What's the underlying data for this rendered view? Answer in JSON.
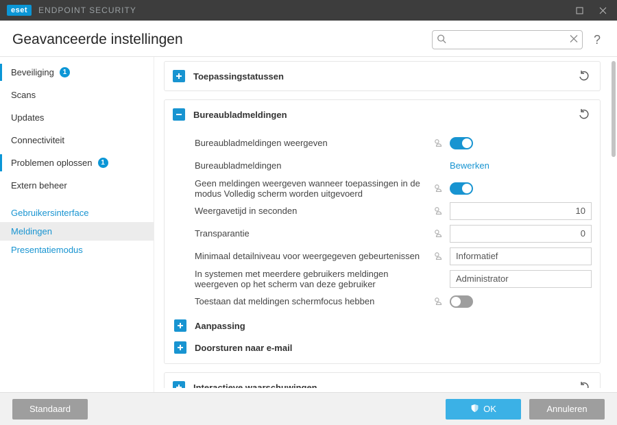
{
  "app": {
    "brand": "eset",
    "product": "ENDPOINT SECURITY"
  },
  "header": {
    "title": "Geavanceerde instellingen",
    "search_placeholder": "",
    "help_text": "?"
  },
  "sidebar": {
    "items": [
      {
        "label": "Beveiliging",
        "badge": "1"
      },
      {
        "label": "Scans"
      },
      {
        "label": "Updates"
      },
      {
        "label": "Connectiviteit"
      },
      {
        "label": "Problemen oplossen",
        "badge": "1"
      },
      {
        "label": "Extern beheer"
      }
    ],
    "subs": [
      {
        "label": "Gebruikersinterface"
      },
      {
        "label": "Meldingen"
      },
      {
        "label": "Presentatiemodus"
      }
    ]
  },
  "panels": {
    "app_statuses": {
      "title": "Toepassingstatussen"
    },
    "desktop": {
      "title": "Bureaubladmeldingen",
      "rows": {
        "show_label": "Bureaubladmeldingen weergeven",
        "config_label": "Bureaubladmeldingen",
        "config_action": "Bewerken",
        "fullscreen_label": "Geen meldingen weergeven wanneer toepassingen in de modus Volledig scherm worden uitgevoerd",
        "duration_label": "Weergavetijd in seconden",
        "duration_value": "10",
        "transparency_label": "Transparantie",
        "transparency_value": "0",
        "verbosity_label": "Minimaal detailniveau voor weergegeven gebeurtenissen",
        "verbosity_value": "Informatief",
        "multiuser_label": "In systemen met meerdere gebruikers meldingen weergeven op het scherm van deze gebruiker",
        "multiuser_value": "Administrator",
        "focus_label": "Toestaan dat meldingen schermfocus hebben"
      },
      "sub_customization": "Aanpassing",
      "sub_forward_email": "Doorsturen naar e-mail"
    },
    "interactive": {
      "title": "Interactieve waarschuwingen"
    }
  },
  "footer": {
    "default_label": "Standaard",
    "ok_label": "OK",
    "cancel_label": "Annuleren"
  }
}
